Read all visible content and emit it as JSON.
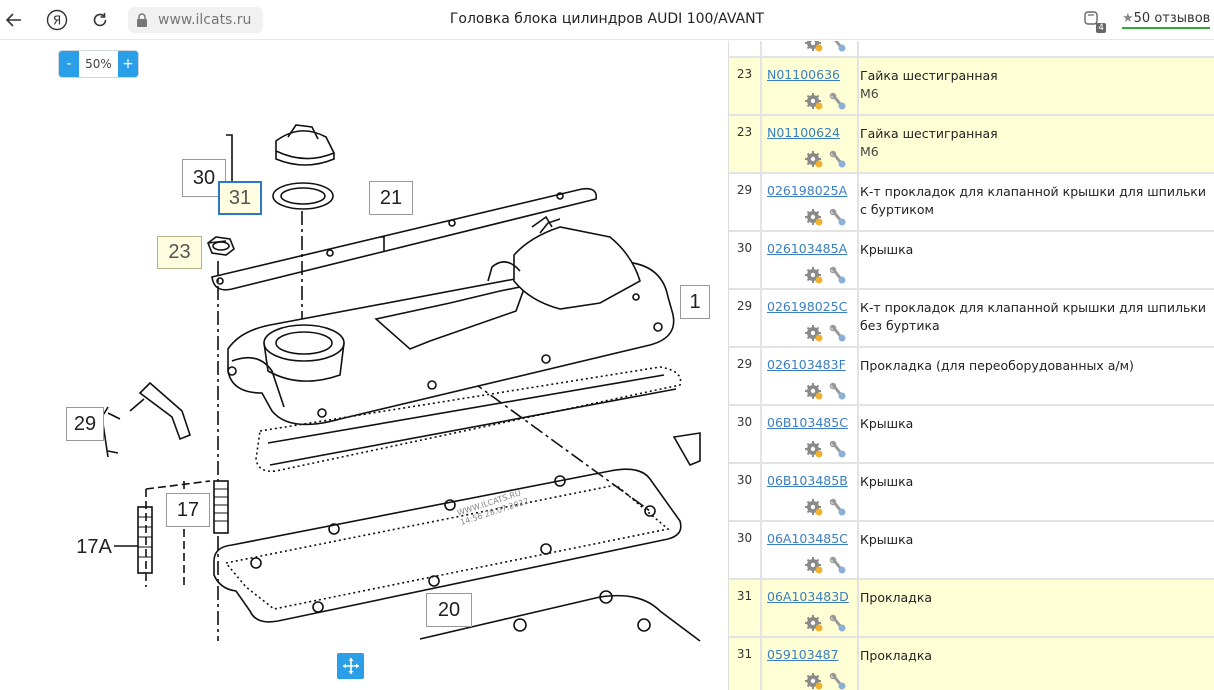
{
  "browser": {
    "url": "www.ilcats.ru",
    "title": "Головка блока цилиндров AUDI 100/AVANT",
    "ext_badge": "4",
    "reviews": "50 отзывов"
  },
  "zoom": {
    "minus": "-",
    "value": "50%",
    "plus": "+"
  },
  "diagram": {
    "labels": [
      "30",
      "31",
      "21",
      "23",
      "29",
      "17",
      "17A",
      "20",
      "1"
    ],
    "watermark_line1": "WWW.ILCATS.RU",
    "watermark_line2": "14:56 28.07.2022"
  },
  "parts": [
    {
      "qty": "23",
      "code": "N01100636",
      "name": "Гайка шестигранная",
      "note": "M6",
      "highlight": true
    },
    {
      "qty": "23",
      "code": "N01100624",
      "name": "Гайка шестигранная",
      "note": "M6",
      "highlight": true
    },
    {
      "qty": "29",
      "code": "026198025A",
      "name": "К-т прокладок для клапанной крышки для шпильки с буртиком",
      "note": "",
      "highlight": false
    },
    {
      "qty": "30",
      "code": "026103485A",
      "name": "Крышка",
      "note": "",
      "highlight": false
    },
    {
      "qty": "29",
      "code": "026198025C",
      "name": "К-т прокладок для клапанной крышки для шпильки без буртика",
      "note": "",
      "highlight": false
    },
    {
      "qty": "29",
      "code": "026103483F",
      "name": "Прокладка (для переоборудованных а/м)",
      "note": "",
      "highlight": false
    },
    {
      "qty": "30",
      "code": "06B103485C",
      "name": "Крышка",
      "note": "",
      "highlight": false
    },
    {
      "qty": "30",
      "code": "06B103485B",
      "name": "Крышка",
      "note": "",
      "highlight": false
    },
    {
      "qty": "30",
      "code": "06A103485C",
      "name": "Крышка",
      "note": "",
      "highlight": false
    },
    {
      "qty": "31",
      "code": "06A103483D",
      "name": "Прокладка",
      "note": "",
      "highlight": true
    },
    {
      "qty": "31",
      "code": "059103487",
      "name": "Прокладка",
      "note": "",
      "highlight": true
    }
  ],
  "colors": {
    "accent": "#2a9fe8",
    "link": "#3a7fc1",
    "highlight_row": "#ffffd6",
    "review_underline": "#33aa33"
  }
}
